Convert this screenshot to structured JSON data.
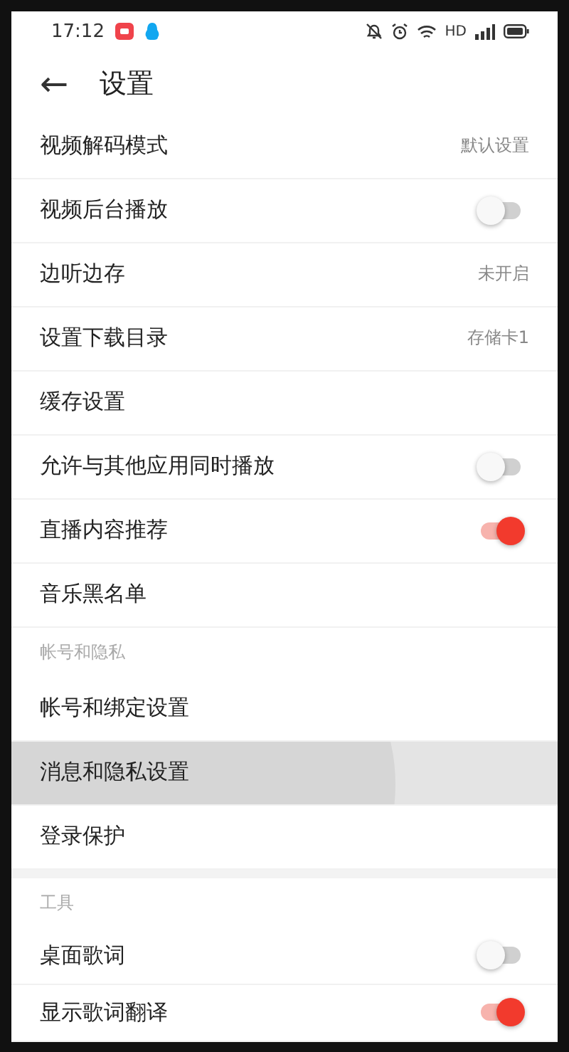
{
  "status_bar": {
    "time": "17:12",
    "network_label": "HD"
  },
  "header": {
    "back_icon": "←",
    "title": "设置"
  },
  "sections": [
    {
      "items": [
        {
          "kind": "value",
          "label": "视频解码模式",
          "value": "默认设置",
          "pressed": false
        },
        {
          "kind": "toggle",
          "label": "视频后台播放",
          "on": false,
          "pressed": false
        },
        {
          "kind": "value",
          "label": "边听边存",
          "value": "未开启",
          "pressed": false
        },
        {
          "kind": "value",
          "label": "设置下载目录",
          "value": "存储卡1",
          "pressed": false
        },
        {
          "kind": "plain",
          "label": "缓存设置",
          "pressed": false
        },
        {
          "kind": "toggle",
          "label": "允许与其他应用同时播放",
          "on": false,
          "pressed": false
        },
        {
          "kind": "toggle",
          "label": "直播内容推荐",
          "on": true,
          "pressed": false
        },
        {
          "kind": "plain",
          "label": "音乐黑名单",
          "pressed": false
        }
      ]
    },
    {
      "title": "帐号和隐私",
      "items": [
        {
          "kind": "plain",
          "label": "帐号和绑定设置",
          "pressed": false
        },
        {
          "kind": "plain",
          "label": "消息和隐私设置",
          "pressed": true
        },
        {
          "kind": "plain",
          "label": "登录保护",
          "pressed": false
        }
      ]
    },
    {
      "title": "工具",
      "items": [
        {
          "kind": "toggle",
          "label": "桌面歌词",
          "on": false,
          "pressed": false
        },
        {
          "kind": "toggle",
          "label": "显示歌词翻译",
          "on": true,
          "pressed": false
        }
      ]
    }
  ]
}
